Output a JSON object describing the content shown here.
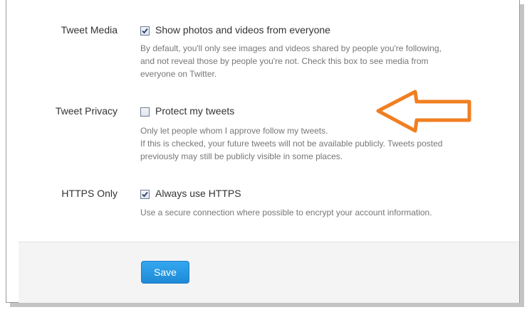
{
  "settings": {
    "tweet_media": {
      "label": "Tweet Media",
      "checkbox_label": "Show photos and videos from everyone",
      "checked": true,
      "help": [
        "By default, you'll only see images and videos shared by people you're following,",
        "and not reveal those by people you're not. Check this box to see media from",
        "everyone on Twitter."
      ]
    },
    "tweet_privacy": {
      "label": "Tweet Privacy",
      "checkbox_label": "Protect my tweets",
      "checked": false,
      "help": [
        "Only let people whom I approve follow my tweets.",
        "If this is checked, your future tweets will not be available publicly. Tweets posted",
        "previously may still be publicly visible in some places."
      ]
    },
    "https_only": {
      "label": "HTTPS Only",
      "checkbox_label": "Always use HTTPS",
      "checked": true,
      "help": [
        "Use a secure connection where possible to encrypt your account information."
      ]
    }
  },
  "footer": {
    "save_label": "Save"
  },
  "colors": {
    "accent_button": "#2a9ae3",
    "annotation_arrow": "#f07f22"
  },
  "annotation": {
    "icon": "left-arrow-icon"
  }
}
